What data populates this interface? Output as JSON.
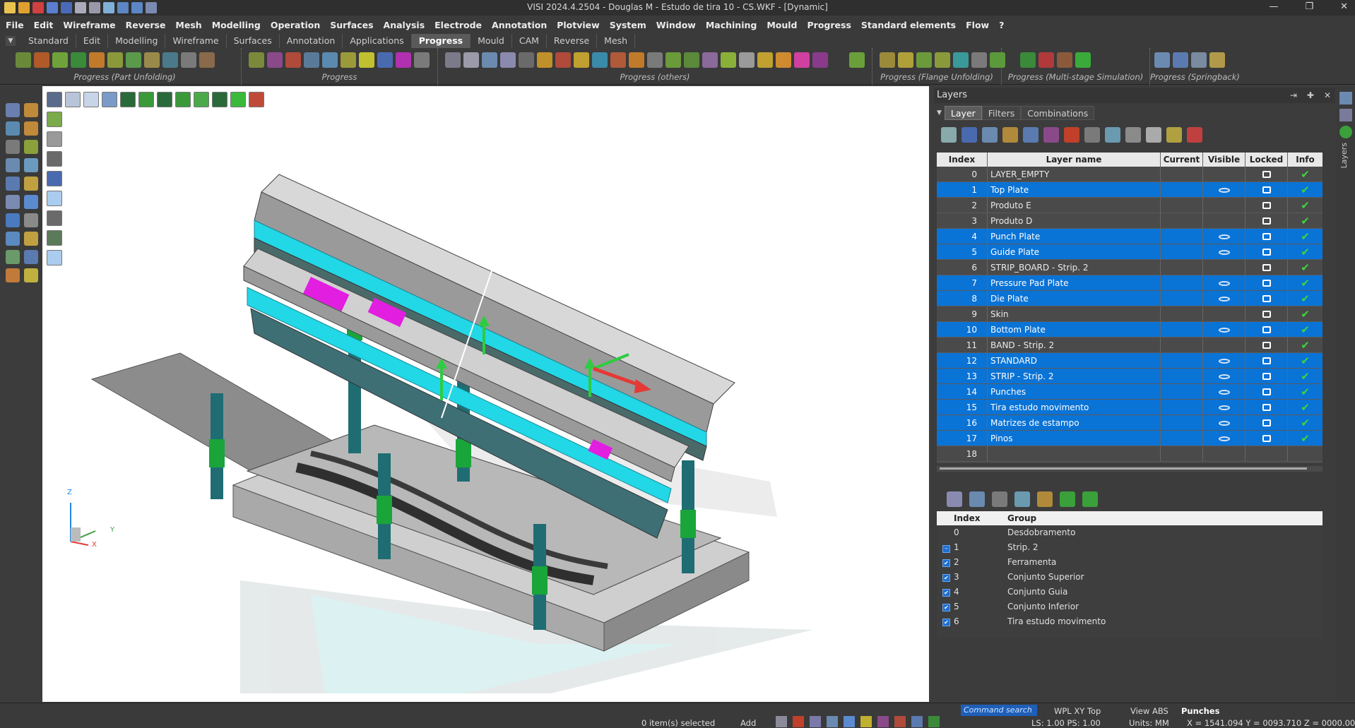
{
  "window": {
    "title": "VISI 2024.4.2504 - Douglas M - Estudo de tira 10 - CS.WKF - [Dynamic]",
    "controls": [
      "—",
      "❐",
      "✕"
    ]
  },
  "menu": [
    "File",
    "Edit",
    "Wireframe",
    "Reverse",
    "Mesh",
    "Modelling",
    "Operation",
    "Surfaces",
    "Analysis",
    "Electrode",
    "Annotation",
    "Plotview",
    "System",
    "Window",
    "Machining",
    "Mould",
    "Progress",
    "Standard elements",
    "Flow",
    "?"
  ],
  "tabs": [
    "Standard",
    "Edit",
    "Modelling",
    "Wireframe",
    "Surfaces",
    "Annotation",
    "Applications",
    "Progress",
    "Mould",
    "CAM",
    "Reverse",
    "Mesh"
  ],
  "active_tab": "Progress",
  "ribbon_groups": [
    {
      "label": "Progress (Part Unfolding)"
    },
    {
      "label": "Progress"
    },
    {
      "label": "Progress (others)"
    },
    {
      "label": "Progress (Flange Unfolding)"
    },
    {
      "label": "Progress (Multi-stage Simulation)"
    },
    {
      "label": "Progress (Springback)"
    }
  ],
  "panel": {
    "title": "Layers",
    "tabs": [
      "Layer",
      "Filters",
      "Combinations"
    ],
    "active_tab": "Layer",
    "layer_headers": [
      "Index",
      "Layer name",
      "Current",
      "Visible",
      "Locked",
      "Info"
    ],
    "layers": [
      {
        "index": "0",
        "name": "LAYER_EMPTY",
        "selected": false,
        "visible": false
      },
      {
        "index": "1",
        "name": "Top Plate",
        "selected": true,
        "visible": true
      },
      {
        "index": "2",
        "name": "Produto E",
        "selected": false,
        "visible": false
      },
      {
        "index": "3",
        "name": "Produto D",
        "selected": false,
        "visible": false
      },
      {
        "index": "4",
        "name": "Punch Plate",
        "selected": true,
        "visible": true
      },
      {
        "index": "5",
        "name": "Guide Plate",
        "selected": true,
        "visible": true
      },
      {
        "index": "6",
        "name": "STRIP_BOARD - Strip. 2",
        "selected": false,
        "visible": false
      },
      {
        "index": "7",
        "name": "Pressure Pad Plate",
        "selected": true,
        "visible": true
      },
      {
        "index": "8",
        "name": "Die Plate",
        "selected": true,
        "visible": true
      },
      {
        "index": "9",
        "name": "Skin",
        "selected": false,
        "visible": false
      },
      {
        "index": "10",
        "name": "Bottom Plate",
        "selected": true,
        "visible": true
      },
      {
        "index": "11",
        "name": "BAND - Strip. 2",
        "selected": false,
        "visible": false
      },
      {
        "index": "12",
        "name": "STANDARD",
        "selected": true,
        "visible": true
      },
      {
        "index": "13",
        "name": "STRIP - Strip. 2",
        "selected": true,
        "visible": true
      },
      {
        "index": "14",
        "name": "Punches",
        "selected": true,
        "visible": true
      },
      {
        "index": "15",
        "name": "Tira estudo movimento",
        "selected": true,
        "visible": true
      },
      {
        "index": "16",
        "name": "Matrizes de estampo",
        "selected": true,
        "visible": true
      },
      {
        "index": "17",
        "name": "Pinos",
        "selected": true,
        "visible": true
      },
      {
        "index": "18",
        "name": "",
        "selected": false,
        "visible": false
      }
    ],
    "group_headers": [
      "Index",
      "Group"
    ],
    "groups": [
      {
        "index": "0",
        "name": "Desdobramento",
        "check": ""
      },
      {
        "index": "1",
        "name": "Strip. 2",
        "check": "partial"
      },
      {
        "index": "2",
        "name": "Ferramenta",
        "check": "on"
      },
      {
        "index": "3",
        "name": "Conjunto Superior",
        "check": "on"
      },
      {
        "index": "4",
        "name": "Conjunto Guia",
        "check": "on"
      },
      {
        "index": "5",
        "name": "Conjunto Inferior",
        "check": "on"
      },
      {
        "index": "6",
        "name": "Tira estudo movimento",
        "check": "on"
      }
    ]
  },
  "sidetab_label": "Layers",
  "status": {
    "selected": "0 item(s) selected",
    "add": "Add",
    "command_search": "Command search",
    "wpl": "WPL XY Top",
    "view": "View ABS",
    "current_layer": "Punches",
    "ls": "LS: 1.00 PS: 1.00",
    "units": "Units: MM",
    "coords": "X = 1541.094 Y = 0093.710 Z = 0000.000"
  },
  "axis": {
    "z": "Z",
    "y": "Y",
    "x": "X"
  },
  "colors": {
    "selection": "#0a73d6",
    "cyan_plate": "#22d7e6",
    "magenta": "#e21ee0",
    "post_green": "#1aa53a",
    "post_teal": "#1f6d73"
  }
}
